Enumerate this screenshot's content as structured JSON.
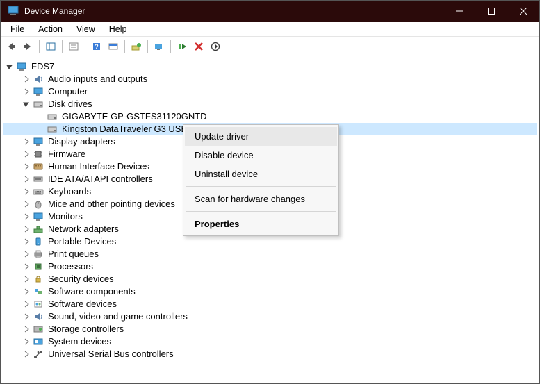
{
  "titlebar": {
    "title": "Device Manager"
  },
  "menubar": [
    "File",
    "Action",
    "View",
    "Help"
  ],
  "tree": {
    "root": "FDS7",
    "nodes": [
      {
        "id": "audio",
        "label": "Audio inputs and outputs",
        "expanded": false,
        "depth": 1,
        "icon": "speaker"
      },
      {
        "id": "computer",
        "label": "Computer",
        "expanded": false,
        "depth": 1,
        "icon": "monitor"
      },
      {
        "id": "diskdrives",
        "label": "Disk drives",
        "expanded": true,
        "depth": 1,
        "icon": "drive"
      },
      {
        "id": "disk1",
        "label": "GIGABYTE GP-GSTFS31120GNTD",
        "expanded": null,
        "depth": 2,
        "icon": "drive"
      },
      {
        "id": "disk2",
        "label": "Kingston DataTraveler G3 USB Device",
        "expanded": null,
        "depth": 2,
        "icon": "drive",
        "selected": true
      },
      {
        "id": "display",
        "label": "Display adapters",
        "expanded": false,
        "depth": 1,
        "icon": "monitor"
      },
      {
        "id": "firmware",
        "label": "Firmware",
        "expanded": false,
        "depth": 1,
        "icon": "chip"
      },
      {
        "id": "hid",
        "label": "Human Interface Devices",
        "expanded": false,
        "depth": 1,
        "icon": "hid"
      },
      {
        "id": "ide",
        "label": "IDE ATA/ATAPI controllers",
        "expanded": false,
        "depth": 1,
        "icon": "ide"
      },
      {
        "id": "keyboards",
        "label": "Keyboards",
        "expanded": false,
        "depth": 1,
        "icon": "keyboard"
      },
      {
        "id": "mice",
        "label": "Mice and other pointing devices",
        "expanded": false,
        "depth": 1,
        "icon": "mouse"
      },
      {
        "id": "monitors",
        "label": "Monitors",
        "expanded": false,
        "depth": 1,
        "icon": "monitor"
      },
      {
        "id": "network",
        "label": "Network adapters",
        "expanded": false,
        "depth": 1,
        "icon": "network"
      },
      {
        "id": "portable",
        "label": "Portable Devices",
        "expanded": false,
        "depth": 1,
        "icon": "portable"
      },
      {
        "id": "printq",
        "label": "Print queues",
        "expanded": false,
        "depth": 1,
        "icon": "printer"
      },
      {
        "id": "processors",
        "label": "Processors",
        "expanded": false,
        "depth": 1,
        "icon": "cpu"
      },
      {
        "id": "security",
        "label": "Security devices",
        "expanded": false,
        "depth": 1,
        "icon": "security"
      },
      {
        "id": "swcomp",
        "label": "Software components",
        "expanded": false,
        "depth": 1,
        "icon": "swcomp"
      },
      {
        "id": "swdev",
        "label": "Software devices",
        "expanded": false,
        "depth": 1,
        "icon": "swdev"
      },
      {
        "id": "sound",
        "label": "Sound, video and game controllers",
        "expanded": false,
        "depth": 1,
        "icon": "speaker"
      },
      {
        "id": "storage",
        "label": "Storage controllers",
        "expanded": false,
        "depth": 1,
        "icon": "storage"
      },
      {
        "id": "system",
        "label": "System devices",
        "expanded": false,
        "depth": 1,
        "icon": "system"
      },
      {
        "id": "usb",
        "label": "Universal Serial Bus controllers",
        "expanded": false,
        "depth": 1,
        "icon": "usb"
      }
    ]
  },
  "context_menu": {
    "items": [
      {
        "label": "Update driver",
        "highlight": true
      },
      {
        "label": "Disable device"
      },
      {
        "label": "Uninstall device"
      },
      {
        "sep": true
      },
      {
        "label": "Scan for hardware changes",
        "hotkey_pos": 0
      },
      {
        "sep": true
      },
      {
        "label": "Properties",
        "bold": true
      }
    ]
  }
}
